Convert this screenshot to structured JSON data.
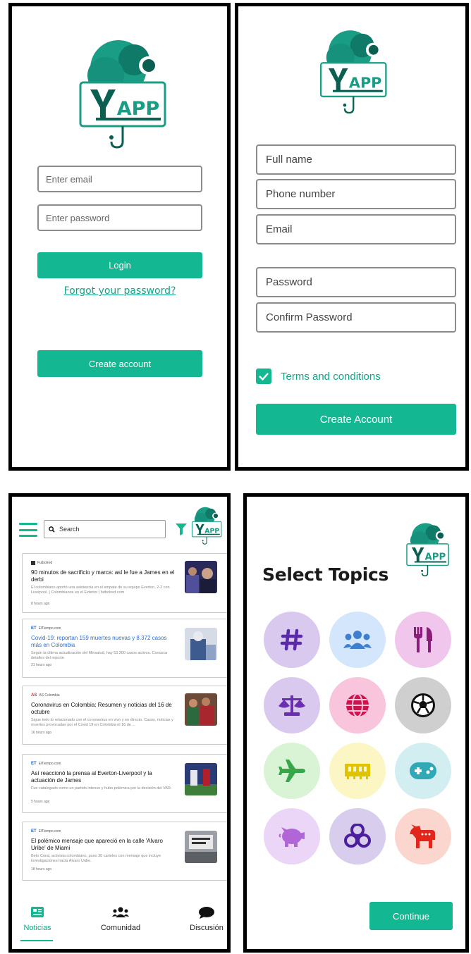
{
  "login": {
    "email_placeholder": "Enter email",
    "password_placeholder": "Enter password",
    "login_label": "Login",
    "forgot_label": "Forgot your password?",
    "create_label": "Create account"
  },
  "register": {
    "fields": [
      "Full name",
      "Phone number",
      "Email",
      "Password",
      "Confirm Password"
    ],
    "terms_label": "Terms and conditions",
    "terms_checked": true,
    "create_label": "Create Account"
  },
  "news": {
    "search_placeholder": "Search",
    "cards": [
      {
        "source": "Futbolred",
        "title": "90 minutos de sacrificio y marca: así le fue a James en el derbi",
        "desc": "El colombiano aportó una asistencia en el empate de su equipo Everton, 2-2 con Liverpool. | Colombianos en el Exterior | futbolred.com",
        "time": "8 hours ago"
      },
      {
        "source": "ElTiempo.com",
        "title": "Covid-19: reportan 159 muertes nuevas y 8.372 casos más en Colombia",
        "desc": "Según la última actualización del Minsalud, hay 53.300 casos activos. Conozca detalles del reporte.",
        "time": "21 hours ago"
      },
      {
        "source": "AS Colombia",
        "title": "Coronavirus en Colombia: Resumen y noticias del 16 de octubre",
        "desc": "Sigue todo lo relacionado con el coronavirus en vivo y en directo. Casos, noticias y muertes provocadas por el Covid 19 en Colombia el 16 de ...",
        "time": "16 hours ago"
      },
      {
        "source": "ElTiempo.com",
        "title": "Así reaccionó la prensa al Everton-Liverpool y la actuación de James",
        "desc": "Fue catalogado como un partido intenso y hubo polémica por la decisión del VAR.",
        "time": "5 hours ago"
      },
      {
        "source": "ElTiempo.com",
        "title": "El polémico mensaje que apareció en la calle 'Alvaro Uribe' de Miami",
        "desc": "Beto Coral, activista colombiano, puso 30 carteles con mensaje que incluye investigaciones hacia Álvaro Uribe.",
        "time": "18 hours ago"
      }
    ],
    "nav": [
      "Noticias",
      "Comunidad",
      "Discusión"
    ]
  },
  "topics": {
    "title": "Select Topics",
    "continue_label": "Continue",
    "items": [
      {
        "icon": "hashtag-icon",
        "bg": "#d9c9ee",
        "fg": "#5a2aa8"
      },
      {
        "icon": "users-icon",
        "bg": "#d4e6fb",
        "fg": "#3e7fd0"
      },
      {
        "icon": "utensils-icon",
        "bg": "#f0c6ec",
        "fg": "#8a1d7a"
      },
      {
        "icon": "scale-icon",
        "bg": "#d9c9ee",
        "fg": "#6a2fb0"
      },
      {
        "icon": "globe-icon",
        "bg": "#f8c5dc",
        "fg": "#d0124d"
      },
      {
        "icon": "soccer-ball-icon",
        "bg": "#cfcfcf",
        "fg": "#111111"
      },
      {
        "icon": "airplane-icon",
        "bg": "#d8f4d4",
        "fg": "#3aa64a"
      },
      {
        "icon": "ticket-icon",
        "bg": "#fbf6c4",
        "fg": "#e1c400"
      },
      {
        "icon": "gamepad-icon",
        "bg": "#d2eef0",
        "fg": "#30a8b5"
      },
      {
        "icon": "piggy-bank-icon",
        "bg": "#ecd6f7",
        "fg": "#b066d7"
      },
      {
        "icon": "biohazard-icon",
        "bg": "#d9cdee",
        "fg": "#4b1e9e"
      },
      {
        "icon": "donkey-icon",
        "bg": "#fbd6cf",
        "fg": "#e2261c"
      }
    ]
  },
  "brand": {
    "accent": "#13b892",
    "logo_text": "APP"
  }
}
